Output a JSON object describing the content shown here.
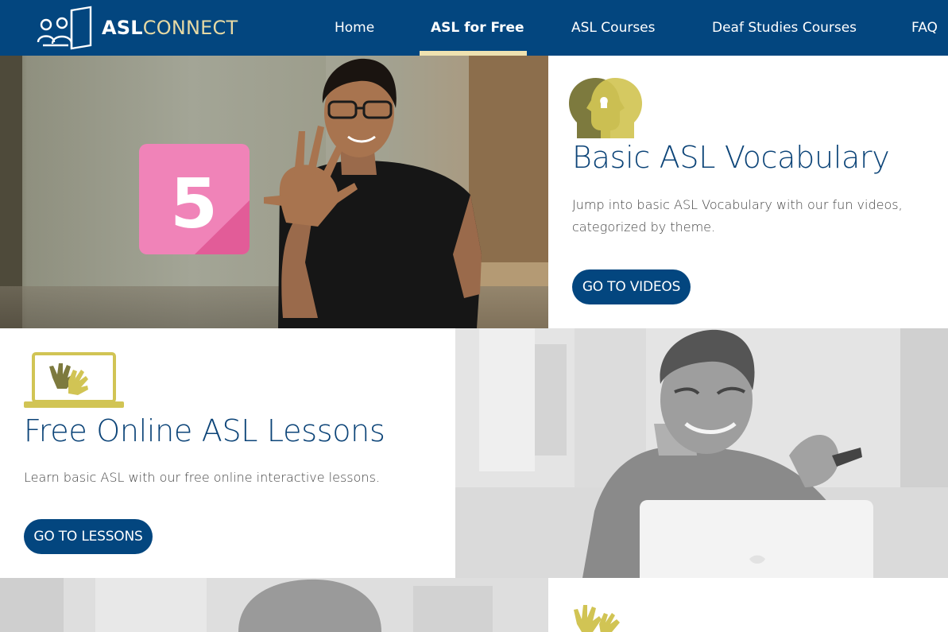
{
  "nav": {
    "logo": {
      "bold": "ASL",
      "light": "CONNECT"
    },
    "items": [
      {
        "label": "Home",
        "active": false
      },
      {
        "label": "ASL for Free",
        "active": true
      },
      {
        "label": "ASL Courses",
        "active": false
      },
      {
        "label": "Deaf Studies Courses",
        "active": false
      },
      {
        "label": "FAQ",
        "active": false
      }
    ],
    "colors": {
      "bar": "#03467f",
      "active_underline": "#efe2b0"
    }
  },
  "sections": [
    {
      "icon": "two-heads-icon",
      "title": "Basic ASL Vocabulary",
      "description": "Jump into basic ASL Vocabulary with our fun videos, categorized by theme.",
      "button": "GO TO VIDEOS",
      "photo_badge": "5"
    },
    {
      "icon": "laptop-hands-icon",
      "title": "Free Online ASL Lessons",
      "description": "Learn basic ASL with our free online interactive lessons.",
      "button": "GO TO LESSONS"
    },
    {
      "icon": "hands-icon"
    }
  ],
  "colors": {
    "heading": "#0c4478",
    "button": "#03467f",
    "accent_gold": "#c9bd55",
    "accent_olive": "#7d7a3e"
  }
}
